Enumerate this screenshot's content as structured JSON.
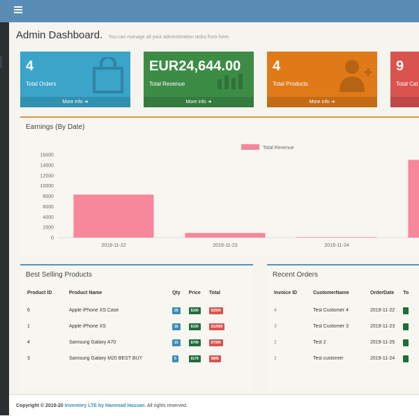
{
  "header": {
    "menu_icon": "hamburger-icon"
  },
  "page": {
    "title": "Admin Dashboard.",
    "subtitle": "You can manage all your administration tasks from here."
  },
  "info_boxes": [
    {
      "value": "4",
      "label": "Total Orders",
      "more": "More info",
      "color": "#3aa4c9",
      "icon": "shopping-bag-icon"
    },
    {
      "value": "EUR24,644.00",
      "label": "Total Revenue",
      "more": "More info",
      "color": "#3c8c46",
      "icon": "bar-chart-icon"
    },
    {
      "value": "4",
      "label": "Total Products",
      "more": "More info",
      "color": "#e07a18",
      "icon": "user-add-icon"
    },
    {
      "value": "9",
      "label": "Total Cat",
      "more": "",
      "color": "#d9534f",
      "icon": ""
    }
  ],
  "chart_panel": {
    "title": "Earnings (By Date)"
  },
  "chart_data": {
    "type": "bar",
    "categories": [
      "2019-11-22",
      "2019-11-23",
      "2019-11-24",
      ""
    ],
    "series": [
      {
        "name": "Total Revenue",
        "values": [
          8300,
          900,
          100,
          15000
        ],
        "color": "#f7879a"
      }
    ],
    "yticks": [
      "16000",
      "14000",
      "12000",
      "10000",
      "8000",
      "6000",
      "4000",
      "2000",
      "0"
    ],
    "ylim": [
      0,
      16000
    ]
  },
  "best_selling": {
    "title": "Best Selling Products",
    "headers": [
      "Product ID",
      "Product Name",
      "Qty",
      "Price",
      "Total"
    ],
    "rows": [
      {
        "id": "6",
        "name": "Apple iPhone XS Case",
        "qty": "25",
        "price": "$100",
        "total": "$2500"
      },
      {
        "id": "1",
        "name": "Apple iPhone XS",
        "qty": "16",
        "price": "$100",
        "total": "$12085"
      },
      {
        "id": "4",
        "name": "Samsung Galaxy A70",
        "qty": "10",
        "price": "$799",
        "total": "$7990"
      },
      {
        "id": "3",
        "name": "Samsung Galaxy M20 BEST BUY",
        "qty": "5",
        "price": "$179",
        "total": "$895"
      }
    ]
  },
  "recent_orders": {
    "title": "Recent Orders",
    "headers": [
      "Invoice ID",
      "CustomerName",
      "OrderDate",
      "To"
    ],
    "rows": [
      {
        "id": "4",
        "customer": "Test Customer 4",
        "date": "2019-11-22"
      },
      {
        "id": "3",
        "customer": "Test Customer 3",
        "date": "2019-11-23"
      },
      {
        "id": "2",
        "customer": "Test 2",
        "date": "2019-11-25"
      },
      {
        "id": "1",
        "customer": "Test customer",
        "date": "2019-11-24"
      }
    ]
  },
  "footer": {
    "copyright": "Copyright © 2019-20",
    "link": "Inventory LTE by Hammad Hassan",
    "rights": ". All rights reserved."
  }
}
